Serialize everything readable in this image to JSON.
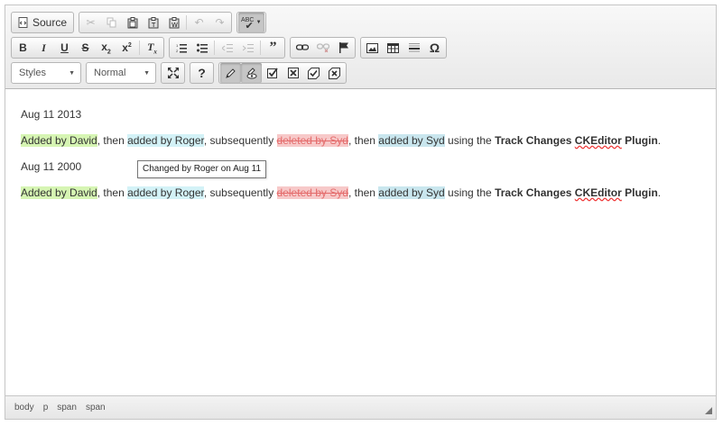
{
  "toolbar": {
    "source_label": "Source",
    "styles_label": "Styles",
    "format_label": "Normal",
    "help_label": "?",
    "spell_label": "ABC"
  },
  "content": {
    "date1": "Aug 11 2013",
    "date2": "Aug 11 2000",
    "line": {
      "added_david": "Added by David",
      "then1": ", then ",
      "added_roger": "added by Roger",
      "subsequently": ", subsequently ",
      "deleted_syd": "deleted by Syd",
      "then2": ", then ",
      "added_syd": "added by Syd",
      "using": " using the ",
      "track_changes": "Track Changes ",
      "ckeditor": "CKEditor",
      "plugin": " Plugin",
      "period": "."
    }
  },
  "tooltip": "Changed by Roger on Aug 11",
  "statusbar": {
    "crumbs": [
      "body",
      "p",
      "span",
      "span"
    ]
  },
  "colors": {
    "insert_david": "#d6f5b3",
    "insert_roger": "#d3f2f7",
    "insert_syd": "#c9e6ee",
    "delete": "#f7c9c9"
  }
}
